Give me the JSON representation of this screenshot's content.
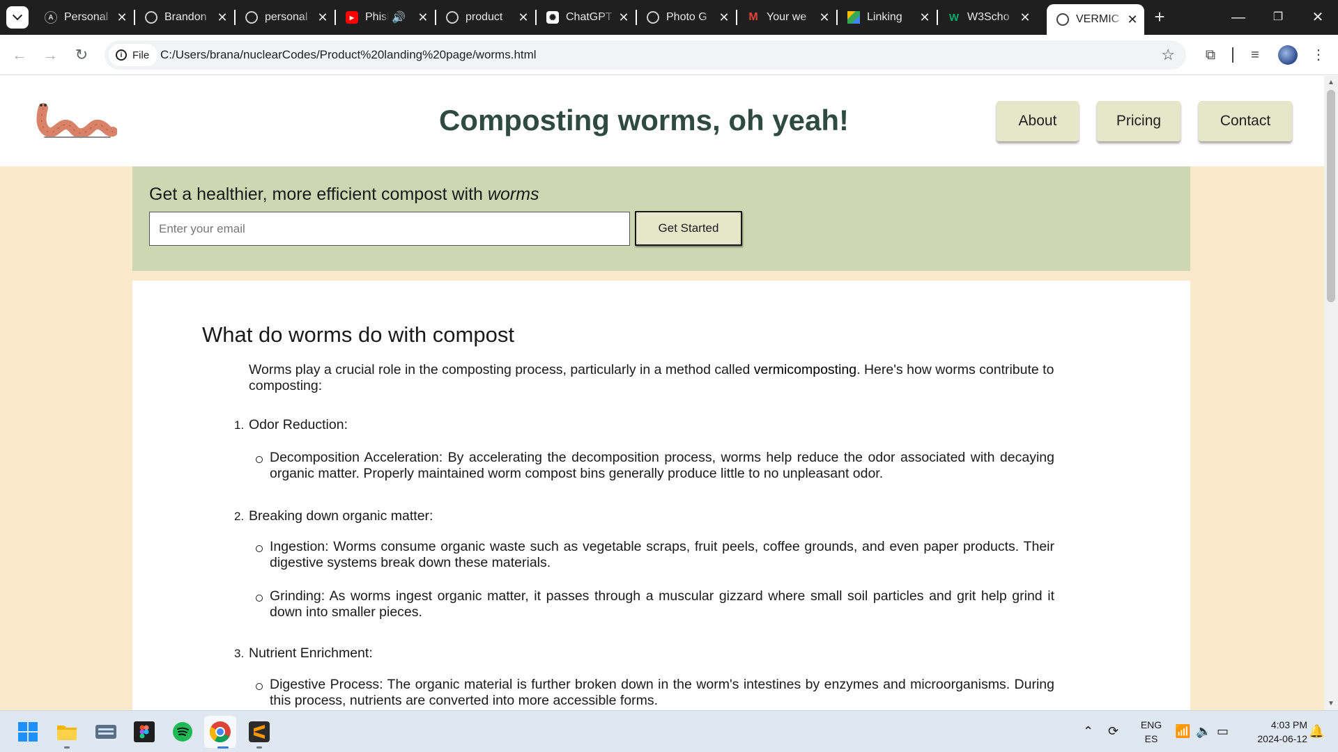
{
  "browser": {
    "tabs": [
      {
        "title": "Personal",
        "favicon": "astro-icon"
      },
      {
        "title": "Brandon",
        "favicon": "globe-icon"
      },
      {
        "title": "personal",
        "favicon": "globe-icon"
      },
      {
        "title": "Phishing",
        "favicon": "youtube-icon"
      },
      {
        "title": "product",
        "favicon": "globe-icon"
      },
      {
        "title": "ChatGPT",
        "favicon": "chatgpt-icon"
      },
      {
        "title": "Photo G",
        "favicon": "globe-icon"
      },
      {
        "title": "Your we",
        "favicon": "gmail-icon"
      },
      {
        "title": "Linking",
        "favicon": "drive-icon"
      },
      {
        "title": "W3Scho",
        "favicon": "w3schools-icon"
      },
      {
        "title": "VERMIC",
        "favicon": "globe-icon",
        "active": true
      }
    ],
    "file_chip": "File",
    "url": "C:/Users/brana/nuclearCodes/Product%20landing%20page/worms.html"
  },
  "page": {
    "title": "Composting worms, oh yeah!",
    "nav": [
      "About",
      "Pricing",
      "Contact"
    ],
    "hero": {
      "heading_prefix": "Get a healthier, more efficient compost with",
      "heading_emphasis": "worms",
      "email_placeholder": "Enter your email",
      "cta_label": "Get Started"
    },
    "section": {
      "heading": "What do worms do with compost",
      "intro_before": "Worms play a crucial role in the composting process, particularly in a method called",
      "intro_bold": "vermicomposting",
      "intro_after": ". Here's how worms contribute to composting:",
      "items": [
        {
          "num": "1.",
          "title": "Odor Reduction:",
          "points": [
            "Decomposition Acceleration: By accelerating the decomposition process, worms help reduce the odor associated with decaying organic matter. Properly maintained worm compost bins generally produce little to no unpleasant odor."
          ]
        },
        {
          "num": "2.",
          "title": "Breaking down organic matter:",
          "points": [
            "Ingestion: Worms consume organic waste such as vegetable scraps, fruit peels, coffee grounds, and even paper products. Their digestive systems break down these materials.",
            "Grinding: As worms ingest organic matter, it passes through a muscular gizzard where small soil particles and grit help grind it down into smaller pieces."
          ]
        },
        {
          "num": "3.",
          "title": "Nutrient Enrichment:",
          "points": [
            "Digestive Process: The organic material is further broken down in the worm's intestines by enzymes and microorganisms. During this process, nutrients are converted into more accessible forms."
          ]
        }
      ]
    }
  },
  "taskbar": {
    "apps": [
      "windows-start-icon",
      "file-explorer-icon",
      "keyboard-app-icon",
      "figma-icon",
      "spotify-icon",
      "chrome-icon",
      "sublime-text-icon"
    ],
    "lang_top": "ENG",
    "lang_bottom": "ES",
    "time": "4:03 PM",
    "date": "2024-06-12"
  },
  "colors": {
    "page_bg": "#faeacb",
    "hero_bg": "#ced7b1",
    "nav_button_bg": "#e5e8c8",
    "title_color": "#2f4a40",
    "worm_color": "#d9826a"
  }
}
